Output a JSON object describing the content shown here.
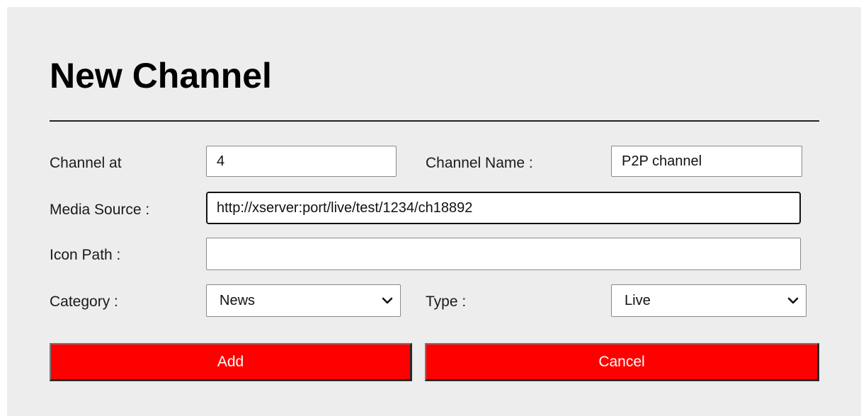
{
  "form": {
    "title": "New Channel",
    "channel_at": {
      "label": "Channel at",
      "value": "4"
    },
    "channel_name": {
      "label": "Channel Name :",
      "value": "P2P channel"
    },
    "media_source": {
      "label": "Media Source :",
      "value": "http://xserver:port/live/test/1234/ch18892"
    },
    "icon_path": {
      "label": "Icon Path :",
      "value": ""
    },
    "category": {
      "label": "Category :",
      "selected": "News"
    },
    "type": {
      "label": "Type :",
      "selected": "Live"
    },
    "buttons": {
      "add": "Add",
      "cancel": "Cancel"
    }
  },
  "colors": {
    "panel_background": "#ededed",
    "button_background": "#ff0000",
    "button_text": "#ffffff"
  },
  "icons": {
    "select_arrow": "chevron-down-icon"
  }
}
